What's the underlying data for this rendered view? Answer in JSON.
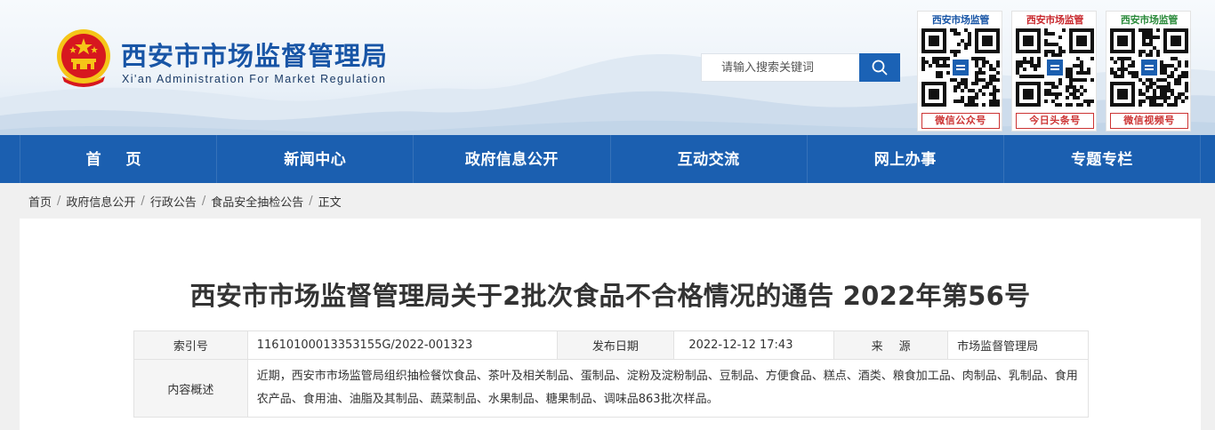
{
  "header": {
    "site_name": "西安市市场监督管理局",
    "site_name_en": "Xi'an Administration For Market Regulation",
    "search_placeholder": "请输入搜索关键词",
    "search_icon": "search-icon",
    "emblem_icon": "national-emblem-icon",
    "qr_codes": [
      {
        "title": "西安市场监管",
        "caption": "微信公众号",
        "title_color": "#1855a6"
      },
      {
        "title": "西安市场监管",
        "caption": "今日头条号",
        "title_color": "#c8272c"
      },
      {
        "title": "西安市场监管",
        "caption": "微信视频号",
        "title_color": "#2a8a3a"
      }
    ]
  },
  "nav": {
    "items": [
      {
        "label": "首 页"
      },
      {
        "label": "新闻中心"
      },
      {
        "label": "政府信息公开"
      },
      {
        "label": "互动交流"
      },
      {
        "label": "网上办事"
      },
      {
        "label": "专题专栏"
      }
    ]
  },
  "breadcrumb": {
    "items": [
      "首页",
      "政府信息公开",
      "行政公告",
      "食品安全抽检公告",
      "正文"
    ],
    "separator": "/"
  },
  "article": {
    "title": "西安市市场监督管理局关于2批次食品不合格情况的通告 2022年第56号",
    "meta": {
      "index_label": "索引号",
      "index_value": "11610100013353155G/2022-001323",
      "date_label": "发布日期",
      "date_value": "2022-12-12 17:43",
      "source_label": "来源",
      "source_value": "市场监督管理局",
      "summary_label": "内容概述",
      "summary_value": "近期，西安市市场监管局组织抽检餐饮食品、茶叶及相关制品、蛋制品、淀粉及淀粉制品、豆制品、方便食品、糕点、酒类、粮食加工品、肉制品、乳制品、食用农产品、食用油、油脂及其制品、蔬菜制品、水果制品、糖果制品、调味品863批次样品。"
    }
  },
  "colors": {
    "brand_blue": "#1b5fb0",
    "title_blue": "#1855a6",
    "emblem_red": "#d7171f",
    "emblem_gold": "#f5c518"
  }
}
